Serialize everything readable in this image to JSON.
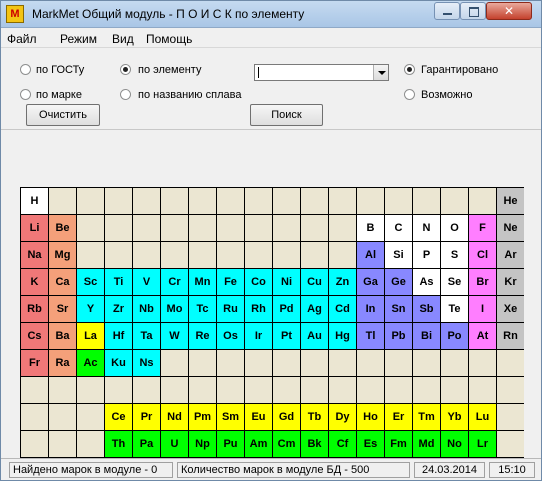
{
  "window": {
    "title": "MarkMet Общий модуль - П О И С К  по элементу",
    "icon_letter": "M"
  },
  "menu": [
    "Файл",
    "Режим",
    "Вид",
    "Помощь"
  ],
  "search_mode": {
    "options": [
      "по ГОСТу",
      "по элементу",
      "по марке",
      "по названию сплава"
    ],
    "selected": "по элементу"
  },
  "element_select": {
    "value": ""
  },
  "guarantee": {
    "options": [
      "Гарантировано",
      "Возможно"
    ],
    "selected": "Гарантировано"
  },
  "buttons": {
    "clear": "Очистить",
    "search": "Поиск"
  },
  "colors": {
    "empty": "#ebe6d2",
    "white": "#ffffff",
    "s_block": "#f07878",
    "alkaline_earth": "#f4a07a",
    "transition": "#00ffff",
    "lanthanide": "#ffff00",
    "actinide": "#00ff00",
    "metalloid": "#8888ff",
    "halogen": "#ff7eff",
    "noble_gas": "#c4c4c4"
  },
  "periodic_table": {
    "rows": [
      [
        [
          "H",
          "white"
        ],
        null,
        null,
        null,
        null,
        null,
        null,
        null,
        null,
        null,
        null,
        null,
        null,
        null,
        null,
        null,
        null,
        [
          "He",
          "noble_gas"
        ]
      ],
      [
        [
          "Li",
          "s_block"
        ],
        [
          "Be",
          "alkaline_earth"
        ],
        null,
        null,
        null,
        null,
        null,
        null,
        null,
        null,
        null,
        null,
        [
          "B",
          "white"
        ],
        [
          "C",
          "white"
        ],
        [
          "N",
          "white"
        ],
        [
          "O",
          "white"
        ],
        [
          "F",
          "halogen"
        ],
        [
          "Ne",
          "noble_gas"
        ]
      ],
      [
        [
          "Na",
          "s_block"
        ],
        [
          "Mg",
          "alkaline_earth"
        ],
        null,
        null,
        null,
        null,
        null,
        null,
        null,
        null,
        null,
        null,
        [
          "Al",
          "metalloid"
        ],
        [
          "Si",
          "white"
        ],
        [
          "P",
          "white"
        ],
        [
          "S",
          "white"
        ],
        [
          "Cl",
          "halogen"
        ],
        [
          "Ar",
          "noble_gas"
        ]
      ],
      [
        [
          "K",
          "s_block"
        ],
        [
          "Ca",
          "alkaline_earth"
        ],
        [
          "Sc",
          "transition"
        ],
        [
          "Ti",
          "transition"
        ],
        [
          "V",
          "transition"
        ],
        [
          "Cr",
          "transition"
        ],
        [
          "Mn",
          "transition"
        ],
        [
          "Fe",
          "transition"
        ],
        [
          "Co",
          "transition"
        ],
        [
          "Ni",
          "transition"
        ],
        [
          "Cu",
          "transition"
        ],
        [
          "Zn",
          "transition"
        ],
        [
          "Ga",
          "metalloid"
        ],
        [
          "Ge",
          "metalloid"
        ],
        [
          "As",
          "white"
        ],
        [
          "Se",
          "white"
        ],
        [
          "Br",
          "halogen"
        ],
        [
          "Kr",
          "noble_gas"
        ]
      ],
      [
        [
          "Rb",
          "s_block"
        ],
        [
          "Sr",
          "alkaline_earth"
        ],
        [
          "Y",
          "transition"
        ],
        [
          "Zr",
          "transition"
        ],
        [
          "Nb",
          "transition"
        ],
        [
          "Mo",
          "transition"
        ],
        [
          "Tc",
          "transition"
        ],
        [
          "Ru",
          "transition"
        ],
        [
          "Rh",
          "transition"
        ],
        [
          "Pd",
          "transition"
        ],
        [
          "Ag",
          "transition"
        ],
        [
          "Cd",
          "transition"
        ],
        [
          "In",
          "metalloid"
        ],
        [
          "Sn",
          "metalloid"
        ],
        [
          "Sb",
          "metalloid"
        ],
        [
          "Te",
          "white"
        ],
        [
          "I",
          "halogen"
        ],
        [
          "Xe",
          "noble_gas"
        ]
      ],
      [
        [
          "Cs",
          "s_block"
        ],
        [
          "Ba",
          "alkaline_earth"
        ],
        [
          "La",
          "lanthanide"
        ],
        [
          "Hf",
          "transition"
        ],
        [
          "Ta",
          "transition"
        ],
        [
          "W",
          "transition"
        ],
        [
          "Re",
          "transition"
        ],
        [
          "Os",
          "transition"
        ],
        [
          "Ir",
          "transition"
        ],
        [
          "Pt",
          "transition"
        ],
        [
          "Au",
          "transition"
        ],
        [
          "Hg",
          "transition"
        ],
        [
          "Tl",
          "metalloid"
        ],
        [
          "Pb",
          "metalloid"
        ],
        [
          "Bi",
          "metalloid"
        ],
        [
          "Po",
          "metalloid"
        ],
        [
          "At",
          "halogen"
        ],
        [
          "Rn",
          "noble_gas"
        ]
      ],
      [
        [
          "Fr",
          "s_block"
        ],
        [
          "Ra",
          "alkaline_earth"
        ],
        [
          "Ac",
          "actinide"
        ],
        [
          "Ku",
          "transition"
        ],
        [
          "Ns",
          "transition"
        ],
        null,
        null,
        null,
        null,
        null,
        null,
        null,
        null,
        null,
        null,
        null,
        null,
        null
      ],
      [
        null,
        null,
        null,
        null,
        null,
        null,
        null,
        null,
        null,
        null,
        null,
        null,
        null,
        null,
        null,
        null,
        null,
        null
      ],
      [
        null,
        null,
        null,
        [
          "Ce",
          "lanthanide"
        ],
        [
          "Pr",
          "lanthanide"
        ],
        [
          "Nd",
          "lanthanide"
        ],
        [
          "Pm",
          "lanthanide"
        ],
        [
          "Sm",
          "lanthanide"
        ],
        [
          "Eu",
          "lanthanide"
        ],
        [
          "Gd",
          "lanthanide"
        ],
        [
          "Tb",
          "lanthanide"
        ],
        [
          "Dy",
          "lanthanide"
        ],
        [
          "Ho",
          "lanthanide"
        ],
        [
          "Er",
          "lanthanide"
        ],
        [
          "Tm",
          "lanthanide"
        ],
        [
          "Yb",
          "lanthanide"
        ],
        [
          "Lu",
          "lanthanide"
        ],
        null
      ],
      [
        null,
        null,
        null,
        [
          "Th",
          "actinide"
        ],
        [
          "Pa",
          "actinide"
        ],
        [
          "U",
          "actinide"
        ],
        [
          "Np",
          "actinide"
        ],
        [
          "Pu",
          "actinide"
        ],
        [
          "Am",
          "actinide"
        ],
        [
          "Cm",
          "actinide"
        ],
        [
          "Bk",
          "actinide"
        ],
        [
          "Cf",
          "actinide"
        ],
        [
          "Es",
          "actinide"
        ],
        [
          "Fm",
          "actinide"
        ],
        [
          "Md",
          "actinide"
        ],
        [
          "No",
          "actinide"
        ],
        [
          "Lr",
          "actinide"
        ],
        null
      ]
    ]
  },
  "status": {
    "found": "Найдено марок в модуле - 0",
    "db_count": "Количество марок в модуле БД - 500",
    "date": "24.03.2014",
    "time": "15:10"
  }
}
